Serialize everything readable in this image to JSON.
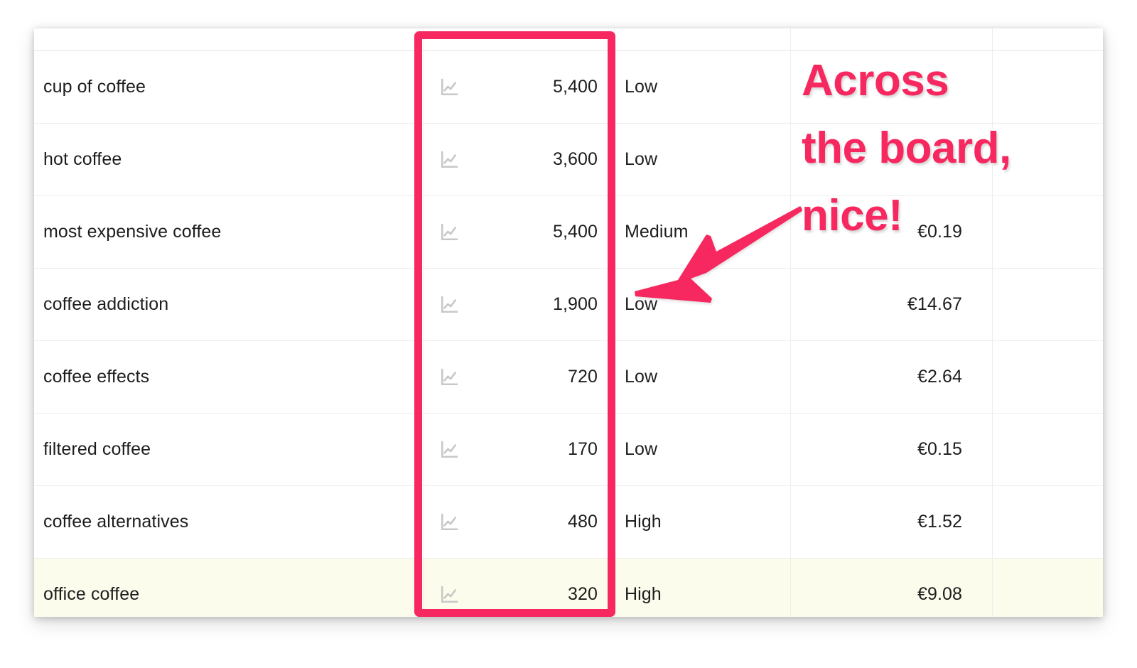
{
  "table": {
    "highlight_note": "volume column outlined in pink",
    "columns": [
      {
        "key": "keyword",
        "align": "left"
      },
      {
        "key": "volume",
        "align": "right"
      },
      {
        "key": "difficulty",
        "align": "left"
      },
      {
        "key": "cpc",
        "align": "right"
      },
      {
        "key": "extra",
        "align": "left"
      }
    ],
    "rows": [
      {
        "keyword": "cup of coffee",
        "icon": "trend-chart-icon",
        "volume": "5,400",
        "difficulty": "Low",
        "cpc": "",
        "extra": "",
        "highlighted": false
      },
      {
        "keyword": "hot coffee",
        "icon": "trend-chart-icon",
        "volume": "3,600",
        "difficulty": "Low",
        "cpc": "",
        "extra": "",
        "highlighted": false
      },
      {
        "keyword": "most expensive coffee",
        "icon": "trend-chart-icon",
        "volume": "5,400",
        "difficulty": "Medium",
        "cpc": "€0.19",
        "extra": "",
        "highlighted": false
      },
      {
        "keyword": "coffee addiction",
        "icon": "trend-chart-icon",
        "volume": "1,900",
        "difficulty": "Low",
        "cpc": "€14.67",
        "extra": "",
        "highlighted": false
      },
      {
        "keyword": "coffee effects",
        "icon": "trend-chart-icon",
        "volume": "720",
        "difficulty": "Low",
        "cpc": "€2.64",
        "extra": "",
        "highlighted": false
      },
      {
        "keyword": "filtered coffee",
        "icon": "trend-chart-icon",
        "volume": "170",
        "difficulty": "Low",
        "cpc": "€0.15",
        "extra": "",
        "highlighted": false
      },
      {
        "keyword": "coffee alternatives",
        "icon": "trend-chart-icon",
        "volume": "480",
        "difficulty": "High",
        "cpc": "€1.52",
        "extra": "",
        "highlighted": false
      },
      {
        "keyword": "office coffee",
        "icon": "trend-chart-icon",
        "volume": "320",
        "difficulty": "High",
        "cpc": "€9.08",
        "extra": "",
        "highlighted": true
      }
    ]
  },
  "annotation": {
    "lines": [
      "Across",
      "the board,",
      "nice!"
    ],
    "arrow": "arrow-pointing-down-left"
  },
  "colors": {
    "accent_pink": "#f7285f",
    "text": "#1d1d1d",
    "row_highlight": "#fcfcec",
    "grid_line": "#ededed",
    "icon_gray": "#c6c6c6",
    "card_background": "#ffffff"
  }
}
